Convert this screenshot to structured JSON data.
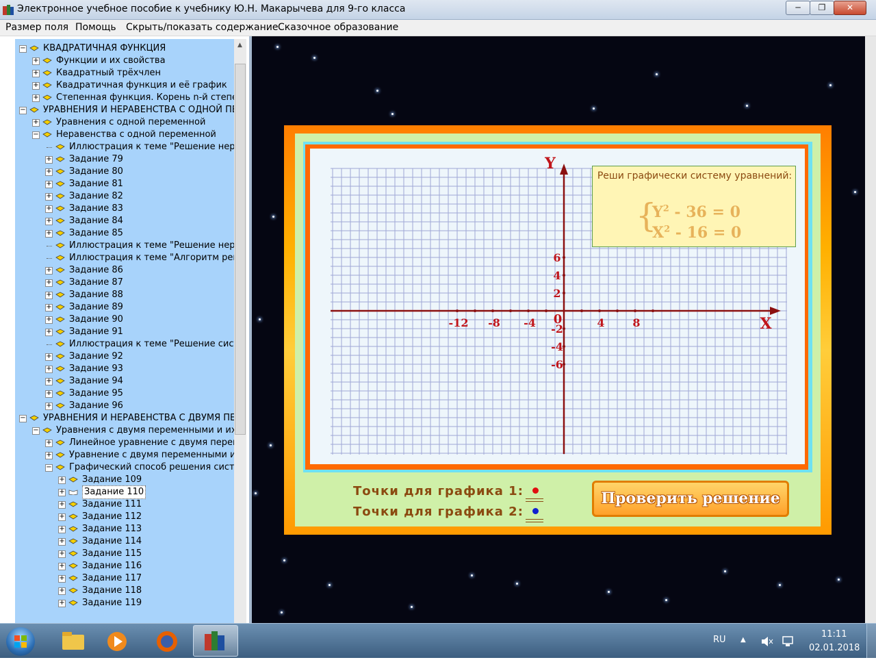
{
  "window": {
    "title": "Электронное учебное пособие к учебнику Ю.Н. Макарычева для 9-го класса",
    "minimize": "─",
    "maximize": "❐",
    "close": "✕"
  },
  "menu": [
    "Размер поля",
    "Помощь",
    "Скрыть/показать содержание",
    "Сказочное образование"
  ],
  "tree": [
    {
      "level": 0,
      "exp": "minus",
      "label": "КВАДРАТИЧНАЯ ФУНКЦИЯ"
    },
    {
      "level": 1,
      "exp": "plus",
      "label": "Функции и их свойства"
    },
    {
      "level": 1,
      "exp": "plus",
      "label": "Квадратный трёхчлен"
    },
    {
      "level": 1,
      "exp": "plus",
      "label": "Квадратичная функция и её график"
    },
    {
      "level": 1,
      "exp": "plus",
      "label": "Степенная функция. Корень n-й степени"
    },
    {
      "level": 0,
      "exp": "minus",
      "label": "УРАВНЕНИЯ И НЕРАВЕНСТВА С ОДНОЙ ПЕРЕМЕННОЙ"
    },
    {
      "level": 1,
      "exp": "plus",
      "label": "Уравнения с одной переменной"
    },
    {
      "level": 1,
      "exp": "minus",
      "label": "Неравенства с одной переменной"
    },
    {
      "level": 2,
      "exp": "none",
      "label": "Иллюстрация к теме \"Решение неравенств\""
    },
    {
      "level": 2,
      "exp": "plus",
      "label": "Задание 79"
    },
    {
      "level": 2,
      "exp": "plus",
      "label": "Задание 80"
    },
    {
      "level": 2,
      "exp": "plus",
      "label": "Задание 81"
    },
    {
      "level": 2,
      "exp": "plus",
      "label": "Задание 82"
    },
    {
      "level": 2,
      "exp": "plus",
      "label": "Задание 83"
    },
    {
      "level": 2,
      "exp": "plus",
      "label": "Задание 84"
    },
    {
      "level": 2,
      "exp": "plus",
      "label": "Задание 85"
    },
    {
      "level": 2,
      "exp": "none",
      "label": "Иллюстрация к теме \"Решение неравенств\""
    },
    {
      "level": 2,
      "exp": "none",
      "label": "Иллюстрация к теме \"Алгоритм решения\""
    },
    {
      "level": 2,
      "exp": "plus",
      "label": "Задание 86"
    },
    {
      "level": 2,
      "exp": "plus",
      "label": "Задание 87"
    },
    {
      "level": 2,
      "exp": "plus",
      "label": "Задание 88"
    },
    {
      "level": 2,
      "exp": "plus",
      "label": "Задание 89"
    },
    {
      "level": 2,
      "exp": "plus",
      "label": "Задание 90"
    },
    {
      "level": 2,
      "exp": "plus",
      "label": "Задание 91"
    },
    {
      "level": 2,
      "exp": "none",
      "label": "Иллюстрация к теме \"Решение систем\""
    },
    {
      "level": 2,
      "exp": "plus",
      "label": "Задание 92"
    },
    {
      "level": 2,
      "exp": "plus",
      "label": "Задание 93"
    },
    {
      "level": 2,
      "exp": "plus",
      "label": "Задание 94"
    },
    {
      "level": 2,
      "exp": "plus",
      "label": "Задание 95"
    },
    {
      "level": 2,
      "exp": "plus",
      "label": "Задание 96"
    },
    {
      "level": 0,
      "exp": "minus",
      "label": "УРАВНЕНИЯ И НЕРАВЕНСТВА С ДВУМЯ ПЕРЕМЕННЫМИ"
    },
    {
      "level": 1,
      "exp": "minus",
      "label": "Уравнения с двумя переменными и их системы"
    },
    {
      "level": 2,
      "exp": "plus",
      "label": "Линейное уравнение с двумя переменными"
    },
    {
      "level": 2,
      "exp": "plus",
      "label": "Уравнение с двумя переменными и его график"
    },
    {
      "level": 2,
      "exp": "minus",
      "label": "Графический способ решения систем уравнений"
    },
    {
      "level": 3,
      "exp": "plus",
      "label": "Задание 109"
    },
    {
      "level": 3,
      "exp": "plus",
      "label": "Задание 110",
      "selected": true
    },
    {
      "level": 3,
      "exp": "plus",
      "label": "Задание 111"
    },
    {
      "level": 3,
      "exp": "plus",
      "label": "Задание 112"
    },
    {
      "level": 3,
      "exp": "plus",
      "label": "Задание 113"
    },
    {
      "level": 3,
      "exp": "plus",
      "label": "Задание 114"
    },
    {
      "level": 3,
      "exp": "plus",
      "label": "Задание 115"
    },
    {
      "level": 3,
      "exp": "plus",
      "label": "Задание 116"
    },
    {
      "level": 3,
      "exp": "plus",
      "label": "Задание 117"
    },
    {
      "level": 3,
      "exp": "plus",
      "label": "Задание 118"
    },
    {
      "level": 3,
      "exp": "plus",
      "label": "Задание 119"
    }
  ],
  "graph": {
    "axis_x_label": "X",
    "axis_y_label": "Y",
    "origin_label": "0",
    "x_ticks": [
      "-12",
      "-8",
      "-4",
      "4",
      "8"
    ],
    "x_tick_values": [
      -12,
      -8,
      -4,
      4,
      8
    ],
    "y_ticks": [
      "6",
      "4",
      "2",
      "-2",
      "-4",
      "-6"
    ],
    "y_tick_values": [
      6,
      4,
      2,
      -2,
      -4,
      -6
    ],
    "axis_color": "#8b1010",
    "grid_color": "#9fa7d6"
  },
  "task": {
    "title": "Реши графически систему уравнений:",
    "brace": "{",
    "eq1_var": "Y",
    "eq1_exp": "2",
    "eq1_rest": " - 36  =  0",
    "eq2_var": "X",
    "eq2_exp": "2",
    "eq2_rest": " - 16  =  0"
  },
  "points": [
    {
      "label": "Точки для графика 1:",
      "color": "#e01010"
    },
    {
      "label": "Точки для графика 2:",
      "color": "#1020d0"
    }
  ],
  "check_button": "Проверить решение",
  "taskbar": {
    "lang": "RU",
    "time": "11:11",
    "date": "02.01.2018",
    "tray_up": "▲",
    "apps": [
      "explorer-icon",
      "media-player-icon",
      "firefox-icon",
      "textbook-app-icon"
    ]
  }
}
